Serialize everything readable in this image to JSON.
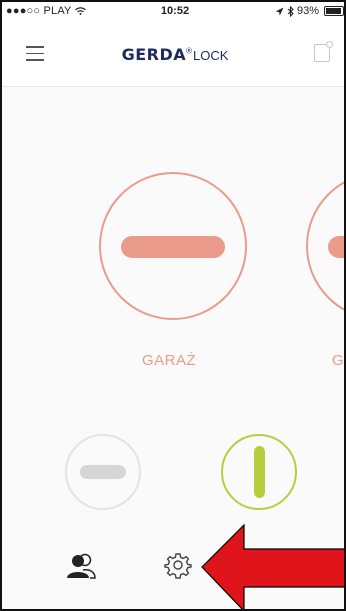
{
  "status_bar": {
    "carrier": "●●●○○ PLAY",
    "wifi_icon": "wifi-icon",
    "time": "10:52",
    "location_icon": "location-arrow-icon",
    "bluetooth_icon": "bluetooth-icon",
    "battery_percent": "93%",
    "battery_level": 0.93
  },
  "header": {
    "menu_icon": "hamburger-menu-icon",
    "logo_brand": "GERDA",
    "logo_reg": "®",
    "logo_sub": "LOCK",
    "door_icon": "door-add-icon"
  },
  "locks": [
    {
      "label": "GARAŻ",
      "state": "locked",
      "color": "#ea9b8c"
    },
    {
      "label": "G",
      "state": "locked",
      "color": "#ea9b8c"
    }
  ],
  "small_locks": [
    {
      "state": "inactive",
      "color": "#d6d6d6"
    },
    {
      "state": "unlocked",
      "color": "#b7cf3f"
    }
  ],
  "bottom_nav": {
    "users_icon": "users-icon",
    "settings_icon": "settings-gear-icon"
  },
  "annotation": {
    "arrow_color": "#e0141b",
    "arrow_direction": "left"
  }
}
